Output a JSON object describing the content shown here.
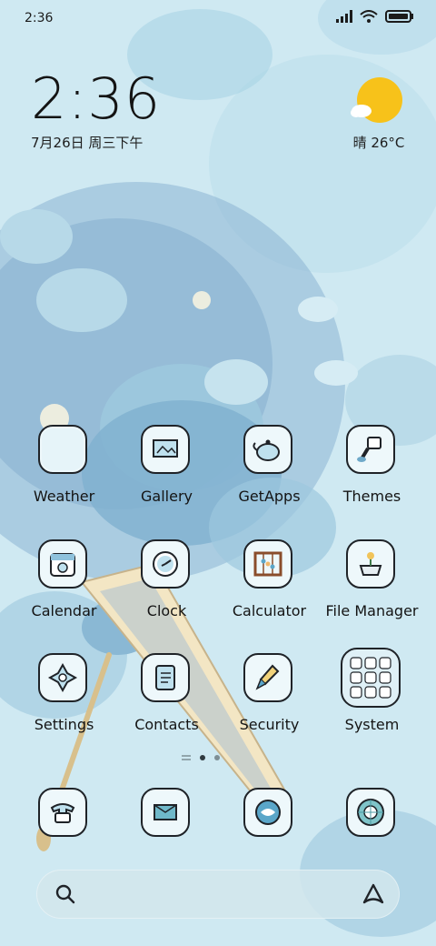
{
  "status_bar": {
    "time": "2:36"
  },
  "clock_widget": {
    "time": "2:36",
    "date": "7月26日 周三下午"
  },
  "weather_widget": {
    "text": "晴 26°C",
    "icon": "sun-behind-cloud-icon"
  },
  "apps": [
    {
      "label": "Weather",
      "icon": "weather-icon"
    },
    {
      "label": "Gallery",
      "icon": "gallery-scroll-icon"
    },
    {
      "label": "GetApps",
      "icon": "teapot-icon"
    },
    {
      "label": "Themes",
      "icon": "paint-brush-icon"
    },
    {
      "label": "Calendar",
      "icon": "calendar-icon"
    },
    {
      "label": "Clock",
      "icon": "clock-icon"
    },
    {
      "label": "Calculator",
      "icon": "abacus-icon"
    },
    {
      "label": "File Manager",
      "icon": "flower-pot-icon"
    },
    {
      "label": "Settings",
      "icon": "settings-flower-icon"
    },
    {
      "label": "Contacts",
      "icon": "contacts-book-icon"
    },
    {
      "label": "Security",
      "icon": "security-brush-icon"
    },
    {
      "label": "System",
      "icon": "system-folder-icon"
    }
  ],
  "dock": [
    {
      "name": "phone",
      "icon": "phone-icon"
    },
    {
      "name": "messages",
      "icon": "messages-icon"
    },
    {
      "name": "browser",
      "icon": "fish-browser-icon"
    },
    {
      "name": "camera",
      "icon": "lotus-leaf-camera-icon"
    }
  ],
  "page_indicator": {
    "pages": 2,
    "current": 1
  },
  "colors": {
    "background": "#cfe9f2",
    "icon_fill": "#eef8fb",
    "outline": "#1f2328",
    "sun": "#f7c21a"
  }
}
